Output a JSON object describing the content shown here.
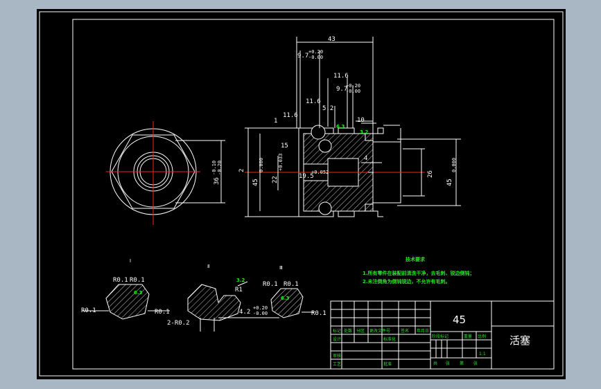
{
  "colors": {
    "background": "#a9b6c4",
    "sheet": "#000000",
    "line": "#ffffff",
    "center": "#ff2020",
    "note": "#29e629",
    "hatch": "#ffffff"
  },
  "dims": {
    "d43": "43",
    "d97a": "9.7",
    "tol_p020": "+0.20",
    "tol_000": "-0.00",
    "d116a": "11.6",
    "d97b": "9.7",
    "d116b": "11.6",
    "d52": "5.2",
    "d116c": "11.6",
    "d1": "1",
    "d10": "10",
    "d15": "15",
    "d45a": "45",
    "d45tol": "0.000",
    "d22": "22",
    "d22tol": "+0.033",
    "d195": "19.5",
    "d195tol": "+0.052",
    "d4": "4",
    "d26": "26",
    "d45b": "45",
    "d36": "36",
    "d36tol": "-0.10",
    "d36tol2": "-0.20",
    "d2": "2",
    "secA": "Ⅰ",
    "secB": "Ⅱ",
    "secC": "Ⅲ",
    "r01a": "R0.1",
    "r01b": "R0.1",
    "r01c": "R0.1",
    "r01d": "R0.1",
    "r1": "R1",
    "r02": "2-R0.2",
    "d42": "4.2",
    "r01e": "R0.1",
    "r01f": "R0.1",
    "r01g": "R0.1",
    "r01h": "R0.1",
    "ra1": "6.3",
    "ra2": "3.2",
    "ra3": "6.3",
    "ra4": "3.2",
    "ra5": "6.3",
    "ra6": "3.2"
  },
  "notes": {
    "title": "技术要求",
    "line1": "1.所有零件在装配前清洗干净，去毛刺、锐边倒钝；",
    "line2": "2.未注倒角为倒钝锐边，不允许有毛刺。"
  },
  "title_block": {
    "material": "45",
    "part_name": "活塞",
    "scale": "1:1",
    "r1": [
      "标记",
      "处数",
      "分区",
      "更改文件号",
      "签名",
      "年月日"
    ],
    "r2": [
      "设计",
      "",
      "",
      "标准化"
    ],
    "r2b": [
      "阶段标记",
      "重量",
      "比例"
    ],
    "r3": [
      "审核"
    ],
    "r4": [
      "工艺",
      "",
      "",
      "批准"
    ],
    "r4b": [
      "共",
      "张",
      "第",
      "张"
    ]
  }
}
